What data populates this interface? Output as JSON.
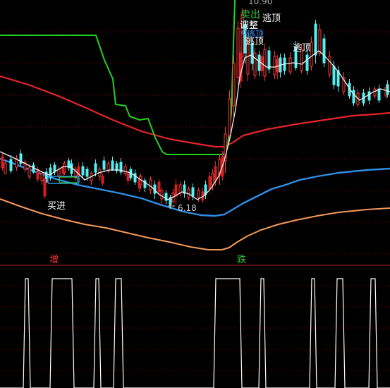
{
  "chart_data": [
    {
      "type": "candlestick",
      "panel": "main",
      "y_domain": [
        0,
        375
      ],
      "lines": {
        "green_stop": [
          [
            0,
            50
          ],
          [
            18,
            50
          ],
          [
            40,
            50
          ],
          [
            60,
            50
          ],
          [
            80,
            50
          ],
          [
            100,
            50
          ],
          [
            120,
            50
          ],
          [
            136,
            50
          ],
          [
            148,
            85
          ],
          [
            160,
            112
          ],
          [
            164,
            148
          ],
          [
            178,
            150
          ],
          [
            184,
            165
          ],
          [
            198,
            170
          ],
          [
            210,
            168
          ],
          [
            220,
            195
          ],
          [
            230,
            215
          ],
          [
            236,
            219
          ],
          [
            260,
            219
          ],
          [
            280,
            219
          ],
          [
            300,
            219
          ],
          [
            317,
            219
          ],
          [
            323,
            205
          ],
          [
            328,
            160
          ],
          [
            333,
            0
          ]
        ],
        "red_ma": [
          [
            0,
            108
          ],
          [
            40,
            120
          ],
          [
            80,
            135
          ],
          [
            120,
            152
          ],
          [
            160,
            170
          ],
          [
            200,
            186
          ],
          [
            240,
            197
          ],
          [
            280,
            204
          ],
          [
            305,
            208
          ],
          [
            318,
            208
          ],
          [
            330,
            202
          ],
          [
            345,
            192
          ],
          [
            380,
            183
          ],
          [
            420,
            176
          ],
          [
            460,
            170
          ],
          [
            500,
            164
          ],
          [
            530,
            162
          ],
          [
            553,
            160
          ]
        ],
        "blue_ma": [
          [
            0,
            225
          ],
          [
            20,
            232
          ],
          [
            40,
            240
          ],
          [
            60,
            247
          ],
          [
            80,
            254
          ],
          [
            110,
            262
          ],
          [
            140,
            268
          ],
          [
            170,
            274
          ],
          [
            200,
            281
          ],
          [
            230,
            291
          ],
          [
            260,
            300
          ],
          [
            285,
            305
          ],
          [
            305,
            306
          ],
          [
            318,
            304
          ],
          [
            330,
            297
          ],
          [
            345,
            288
          ],
          [
            365,
            278
          ],
          [
            385,
            268
          ],
          [
            405,
            262
          ],
          [
            425,
            255
          ],
          [
            450,
            250
          ],
          [
            480,
            245
          ],
          [
            520,
            241
          ],
          [
            553,
            239
          ]
        ],
        "orange_ma": [
          [
            0,
            282
          ],
          [
            30,
            293
          ],
          [
            60,
            303
          ],
          [
            90,
            311
          ],
          [
            120,
            318
          ],
          [
            150,
            323
          ],
          [
            180,
            330
          ],
          [
            210,
            337
          ],
          [
            240,
            343
          ],
          [
            270,
            350
          ],
          [
            295,
            354
          ],
          [
            315,
            354
          ],
          [
            325,
            351
          ],
          [
            335,
            344
          ],
          [
            350,
            335
          ],
          [
            370,
            326
          ],
          [
            395,
            318
          ],
          [
            420,
            312
          ],
          [
            450,
            306
          ],
          [
            480,
            301
          ],
          [
            520,
            297
          ],
          [
            553,
            295
          ]
        ],
        "white_smooth": [
          [
            0,
            215
          ],
          [
            20,
            224
          ],
          [
            40,
            234
          ],
          [
            60,
            244
          ],
          [
            70,
            248
          ],
          [
            80,
            242
          ],
          [
            90,
            236
          ],
          [
            100,
            236
          ],
          [
            110,
            245
          ],
          [
            120,
            255
          ],
          [
            130,
            250
          ],
          [
            140,
            245
          ],
          [
            155,
            241
          ],
          [
            170,
            241
          ],
          [
            185,
            245
          ],
          [
            200,
            255
          ],
          [
            215,
            265
          ],
          [
            225,
            275
          ],
          [
            238,
            283
          ],
          [
            248,
            278
          ],
          [
            258,
            272
          ],
          [
            268,
            275
          ],
          [
            280,
            283
          ],
          [
            290,
            277
          ],
          [
            300,
            266
          ],
          [
            310,
            250
          ],
          [
            318,
            228
          ],
          [
            326,
            196
          ],
          [
            334,
            155
          ],
          [
            340,
            110
          ],
          [
            347,
            82
          ],
          [
            356,
            78
          ],
          [
            366,
            86
          ],
          [
            378,
            95
          ],
          [
            390,
            95
          ],
          [
            402,
            91
          ],
          [
            416,
            89
          ],
          [
            428,
            91
          ],
          [
            440,
            81
          ],
          [
            452,
            72
          ],
          [
            460,
            79
          ],
          [
            470,
            90
          ],
          [
            480,
            102
          ],
          [
            490,
            117
          ],
          [
            500,
            132
          ],
          [
            510,
            142
          ],
          [
            520,
            136
          ],
          [
            530,
            130
          ],
          [
            540,
            126
          ],
          [
            553,
            130
          ]
        ]
      },
      "candles_up": [
        [
          6,
          232,
          14,
          228,
          240
        ],
        [
          22,
          225,
          12,
          220,
          242
        ],
        [
          34,
          230,
          10,
          226,
          244
        ],
        [
          40,
          238,
          12,
          233,
          254
        ],
        [
          58,
          246,
          10,
          242,
          262
        ],
        [
          82,
          240,
          10,
          236,
          254
        ],
        [
          90,
          232,
          12,
          228,
          248
        ],
        [
          106,
          240,
          12,
          236,
          256
        ],
        [
          128,
          246,
          10,
          242,
          262
        ],
        [
          140,
          240,
          10,
          236,
          256
        ],
        [
          152,
          232,
          10,
          228,
          246
        ],
        [
          176,
          236,
          10,
          232,
          250
        ],
        [
          198,
          250,
          12,
          246,
          268
        ],
        [
          212,
          255,
          14,
          250,
          275
        ],
        [
          228,
          270,
          12,
          266,
          290
        ],
        [
          244,
          274,
          12,
          268,
          288
        ],
        [
          254,
          262,
          12,
          258,
          278
        ],
        [
          266,
          268,
          12,
          264,
          284
        ],
        [
          280,
          270,
          10,
          266,
          286
        ],
        [
          300,
          246,
          16,
          240,
          270
        ],
        [
          310,
          226,
          22,
          218,
          262
        ],
        [
          318,
          190,
          38,
          180,
          245
        ],
        [
          324,
          140,
          52,
          128,
          200
        ],
        [
          330,
          90,
          60,
          78,
          165
        ],
        [
          336,
          40,
          70,
          30,
          120
        ],
        [
          342,
          20,
          60,
          12,
          90
        ],
        [
          350,
          55,
          50,
          45,
          115
        ],
        [
          360,
          75,
          32,
          68,
          112
        ],
        [
          374,
          70,
          38,
          62,
          115
        ],
        [
          388,
          80,
          26,
          72,
          112
        ],
        [
          410,
          82,
          20,
          74,
          106
        ],
        [
          426,
          70,
          30,
          62,
          104
        ],
        [
          440,
          60,
          34,
          52,
          100
        ],
        [
          452,
          42,
          34,
          34,
          80
        ],
        [
          466,
          80,
          26,
          72,
          110
        ],
        [
          486,
          110,
          20,
          102,
          135
        ],
        [
          506,
          132,
          16,
          126,
          152
        ],
        [
          530,
          126,
          10,
          122,
          140
        ],
        [
          546,
          124,
          12,
          120,
          140
        ]
      ],
      "candles_cyan": [
        [
          14,
          226,
          16,
          220,
          246
        ],
        [
          28,
          218,
          14,
          212,
          236
        ],
        [
          46,
          234,
          10,
          230,
          246
        ],
        [
          64,
          244,
          14,
          238,
          260
        ],
        [
          70,
          238,
          14,
          232,
          256
        ],
        [
          76,
          234,
          10,
          230,
          248
        ],
        [
          96,
          228,
          10,
          224,
          242
        ],
        [
          100,
          232,
          14,
          226,
          250
        ],
        [
          116,
          236,
          12,
          230,
          252
        ],
        [
          122,
          240,
          10,
          236,
          256
        ],
        [
          134,
          232,
          12,
          226,
          250
        ],
        [
          146,
          228,
          12,
          222,
          244
        ],
        [
          158,
          228,
          12,
          222,
          242
        ],
        [
          164,
          232,
          10,
          228,
          246
        ],
        [
          170,
          230,
          14,
          224,
          248
        ],
        [
          184,
          240,
          12,
          236,
          256
        ],
        [
          190,
          246,
          12,
          240,
          262
        ],
        [
          204,
          256,
          10,
          252,
          272
        ],
        [
          218,
          262,
          12,
          256,
          282
        ],
        [
          234,
          274,
          10,
          270,
          290
        ],
        [
          240,
          280,
          10,
          276,
          296
        ],
        [
          260,
          262,
          12,
          256,
          280
        ],
        [
          272,
          266,
          12,
          260,
          284
        ],
        [
          290,
          262,
          14,
          256,
          282
        ],
        [
          346,
          35,
          40,
          28,
          90
        ],
        [
          356,
          62,
          28,
          55,
          100
        ],
        [
          366,
          78,
          22,
          72,
          108
        ],
        [
          380,
          72,
          26,
          66,
          104
        ],
        [
          396,
          82,
          20,
          76,
          110
        ],
        [
          402,
          82,
          18,
          76,
          106
        ],
        [
          418,
          66,
          30,
          58,
          100
        ],
        [
          434,
          78,
          22,
          72,
          106
        ],
        [
          446,
          34,
          44,
          28,
          90
        ],
        [
          458,
          55,
          34,
          48,
          95
        ],
        [
          472,
          94,
          26,
          86,
          126
        ],
        [
          478,
          100,
          22,
          94,
          130
        ],
        [
          494,
          118,
          18,
          112,
          140
        ],
        [
          500,
          128,
          18,
          122,
          150
        ],
        [
          514,
          132,
          14,
          126,
          150
        ],
        [
          522,
          130,
          12,
          124,
          148
        ],
        [
          536,
          126,
          16,
          120,
          146
        ],
        [
          548,
          120,
          14,
          114,
          138
        ]
      ],
      "candles_red": [
        [
          2,
          222,
          16,
          216,
          242
        ],
        [
          52,
          240,
          14,
          236,
          258
        ],
        [
          62,
          254,
          24,
          246,
          282
        ],
        [
          88,
          236,
          10,
          230,
          250
        ],
        [
          110,
          236,
          14,
          230,
          254
        ],
        [
          144,
          250,
          10,
          246,
          264
        ],
        [
          180,
          246,
          10,
          242,
          262
        ],
        [
          196,
          254,
          12,
          248,
          272
        ],
        [
          224,
          258,
          14,
          254,
          278
        ],
        [
          248,
          262,
          16,
          254,
          290
        ],
        [
          286,
          272,
          12,
          266,
          288
        ],
        [
          296,
          250,
          18,
          244,
          274
        ],
        [
          304,
          236,
          20,
          228,
          264
        ],
        [
          314,
          222,
          28,
          214,
          256
        ],
        [
          340,
          75,
          40,
          66,
          125
        ],
        [
          370,
          80,
          20,
          74,
          108
        ],
        [
          392,
          84,
          18,
          78,
          112
        ]
      ],
      "annotations": {
        "sell": "卖出",
        "adjust": "调整",
        "escape_top_1": "逃顶",
        "escape_top_2": "逃顶",
        "escape_top_3": "逃顶",
        "escape_top_4": "逃顶",
        "buy_in": "买进",
        "low_price": "6.18",
        "top_cut": "10.90"
      },
      "markers": {
        "arrow_low": [
          239,
          292
        ]
      },
      "pills": [
        {
          "kind": "box-left",
          "color": "#1e90ff",
          "text": ""
        },
        {
          "kind": "box-mid",
          "color": "#33cc33",
          "text": ""
        }
      ]
    },
    {
      "type": "step",
      "panel": "lower",
      "labels": {
        "increase": "增",
        "drop": "跌"
      },
      "pulses": [
        [
          36,
          40
        ],
        [
          74,
          102
        ],
        [
          136,
          140
        ],
        [
          164,
          172
        ],
        [
          306,
          340
        ],
        [
          370,
          374
        ],
        [
          442,
          446
        ],
        [
          478,
          486
        ],
        [
          526,
          532
        ]
      ],
      "high": 395,
      "low": 550
    }
  ]
}
